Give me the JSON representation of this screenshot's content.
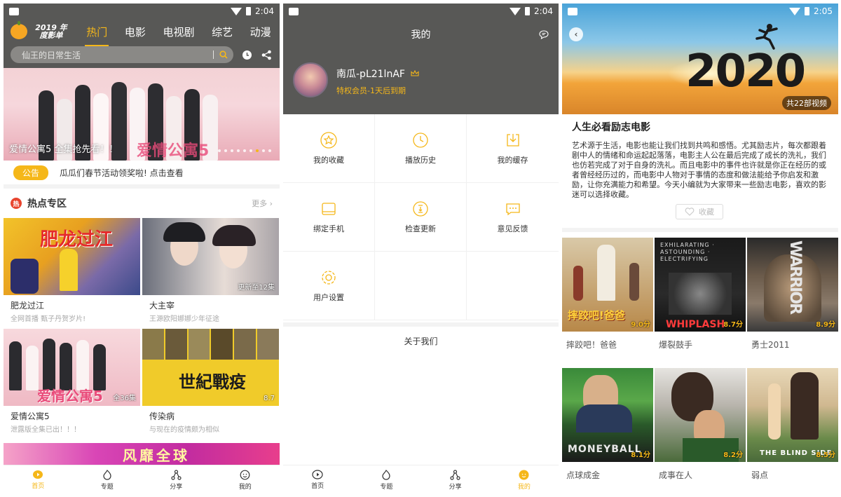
{
  "status": {
    "time1": "2:04",
    "time2": "2:04",
    "time3": "2:05"
  },
  "home": {
    "logo_text": "2019 年度影单",
    "tabs": [
      {
        "label": "热门",
        "active": true
      },
      {
        "label": "电影",
        "active": false
      },
      {
        "label": "电视剧",
        "active": false
      },
      {
        "label": "综艺",
        "active": false
      },
      {
        "label": "动漫",
        "active": false
      }
    ],
    "search_placeholder": "仙王的日常生活",
    "banner": {
      "title": "爱情公寓5 全集抢先看！！",
      "bg_title": "爱情公寓5",
      "dot_count": 9,
      "active_dot": 6
    },
    "notice": {
      "tag": "公告",
      "text": "瓜瓜们春节活动领奖啦!  点击查看"
    },
    "hot": {
      "title": "热点专区",
      "more": "更多"
    },
    "cards": [
      {
        "title": "肥龙过江",
        "sub": "全网首播 甄子丹贺岁片!",
        "badge": "",
        "poster_text": "肥龙过江"
      },
      {
        "title": "大主宰",
        "sub": "王源欧阳娜娜少年征途",
        "badge": "更新至12集",
        "poster_text": ""
      },
      {
        "title": "爱情公寓5",
        "sub": "泄露版全集已出！！！",
        "badge": "全36集",
        "poster_text": "爱情公寓5"
      },
      {
        "title": "传染病",
        "sub": "与现在的疫情颇为相似",
        "badge": "8.7",
        "poster_text": "世紀戰疫"
      }
    ],
    "ad_text": "风靡全球"
  },
  "tabbar": [
    {
      "label": "首页",
      "icon": "home-icon"
    },
    {
      "label": "专题",
      "icon": "topic-icon"
    },
    {
      "label": "分享",
      "icon": "share-icon"
    },
    {
      "label": "我的",
      "icon": "profile-icon"
    }
  ],
  "profile": {
    "title": "我的",
    "username": "南瓜-pL21lnAF",
    "vip_text": "特权会员-1天后到期",
    "menu": [
      {
        "label": "我的收藏",
        "icon": "star-icon"
      },
      {
        "label": "播放历史",
        "icon": "clock-icon"
      },
      {
        "label": "我的缓存",
        "icon": "download-icon"
      },
      {
        "label": "绑定手机",
        "icon": "phone-icon"
      },
      {
        "label": "检查更新",
        "icon": "update-icon"
      },
      {
        "label": "意见反馈",
        "icon": "feedback-icon"
      },
      {
        "label": "用户设置",
        "icon": "settings-icon"
      }
    ],
    "about": "关于我们"
  },
  "topic": {
    "hero_year": "2020",
    "count_badge": "共22部视频",
    "title": "人生必看励志电影",
    "desc": "艺术源于生活，电影也能让我们找到共鸣和感悟。尤其励志片，每次都跟着剧中人的情绪和命运起起落落，电影主人公在最后完成了成长的洗礼，我们也仿若完成了对于自身的洗礼。而且电影中的事件也许就是你正在经历的或者曾经经历过的，而电影中人物对于事情的态度和做法能给予你启发和激励，让你充满能力和希望。今天小编就为大家带来一些励志电影，喜欢的影迷可以选择收藏。",
    "fav_label": "收藏",
    "films": [
      {
        "title": "摔跤吧！爸爸",
        "score": "9.0分",
        "poster_text": "摔跤吧!爸爸"
      },
      {
        "title": "爆裂鼓手",
        "score": "8.7分",
        "poster_text": "WHIPLASH"
      },
      {
        "title": "勇士2011",
        "score": "8.9分",
        "poster_text": "WARRIOR"
      },
      {
        "title": "点球成金",
        "score": "8.1分",
        "poster_text": "MONEYBALL"
      },
      {
        "title": "成事在人",
        "score": "8.2分",
        "poster_text": ""
      },
      {
        "title": "弱点",
        "score": "8.5分",
        "poster_text": "THE BLIND SIDE"
      }
    ]
  }
}
